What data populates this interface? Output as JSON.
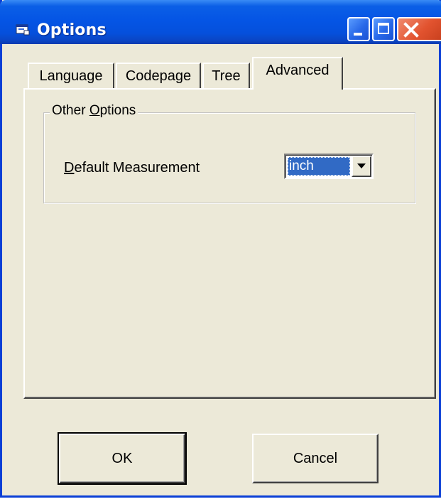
{
  "window": {
    "title": "Options",
    "icon": "app-window-icon",
    "controls": [
      "minimize-icon",
      "maximize-icon",
      "close-icon"
    ],
    "accent_color": "#0555e5",
    "close_color": "#e2532f"
  },
  "tabs": [
    {
      "label": "Language",
      "active": false
    },
    {
      "label": "Codepage",
      "active": false
    },
    {
      "label": "Tree",
      "active": false
    },
    {
      "label": "Advanced",
      "active": true
    }
  ],
  "group": {
    "legend": "Other Options",
    "legend_underlined_letter": "O"
  },
  "default_measurement": {
    "label": "Default Measurement",
    "value": "inch"
  },
  "buttons": {
    "ok": "OK",
    "cancel": "Cancel"
  }
}
